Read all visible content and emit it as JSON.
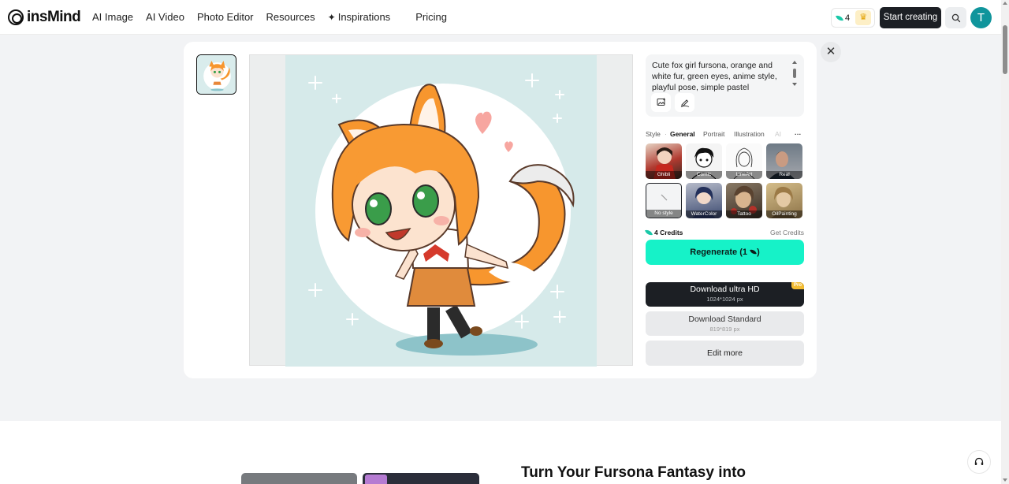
{
  "brand": {
    "name": "insMind"
  },
  "nav": {
    "items": [
      "AI Image",
      "AI Video",
      "Photo Editor",
      "Resources",
      "Inspirations",
      "Pricing"
    ]
  },
  "header": {
    "credits": "4",
    "start_label": "Start creating",
    "avatar_initial": "T"
  },
  "prompt": {
    "text": "Cute fox girl fursona, orange and white fur, green eyes, anime style, playful pose, simple pastel"
  },
  "styles": {
    "label": "Style",
    "tabs": [
      "General",
      "Portrait",
      "Illustration",
      "AI"
    ],
    "more": "···",
    "cards": [
      "Ghibli",
      "Comic",
      "LineArt",
      "Real",
      "No style",
      "WaterColor",
      "Tattoo",
      "OilPainting"
    ]
  },
  "credits": {
    "amount": "4 Credits",
    "get_label": "Get Credits"
  },
  "actions": {
    "regenerate": "Regenerate (1",
    "regenerate_suffix": ")",
    "ultra_hd": "Download ultra HD",
    "ultra_hd_size": "1024*1024 px",
    "pro_badge": "Pro",
    "standard": "Download Standard",
    "standard_size": "819*819 px",
    "edit_more": "Edit more"
  },
  "section": {
    "headline": "Turn Your Fursona Fantasy into"
  },
  "colors": {
    "accent": "#16f2c8",
    "dark_button": "#1c1f24",
    "avatar": "#10959c"
  }
}
